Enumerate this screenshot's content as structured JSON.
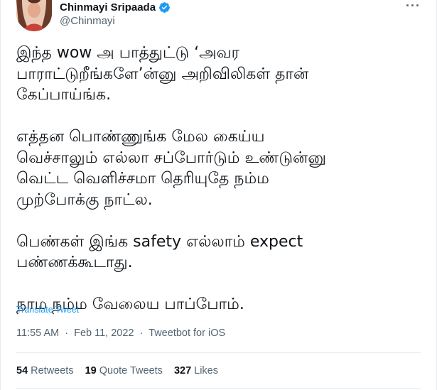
{
  "user": {
    "name": "Chinmayi Sripaada",
    "handle": "@Chinmayi",
    "verified_icon": "verified-badge-icon",
    "verified_color": "#1d9bf0"
  },
  "more_icon": "···",
  "tweet": {
    "paragraphs": [
      "இந்த wow அ பாத்துட்டு ‘அவர\nபாராட்டுறீங்களே’ன்னு அறிவிலிகள் தான்\nகேப்பாய்ங்க.",
      "எத்தன பொண்ணுங்க மேல கைய்ய\nவெச்சாலும் எல்லா சப்போர்டும் உண்டுன்னு\nவெட்ட வெளிச்சமா தெரியுதே நம்ம\nமுற்போக்கு நாட்ல.",
      "பெண்கள் இங்க safety எல்லாம் expect\nபண்ணக்கூடாது.",
      "நாம நம்ம வேலைய பாப்போம்."
    ],
    "translate_label": "Translate Tweet",
    "time": "11:55 AM",
    "date": "Feb 11, 2022",
    "client": "Tweetbot for iOS",
    "separator": "·"
  },
  "stats": {
    "retweets_count": "54",
    "retweets_label": "Retweets",
    "quotes_count": "19",
    "quotes_label": "Quote Tweets",
    "likes_count": "327",
    "likes_label": "Likes"
  },
  "colors": {
    "text": "#0f1419",
    "secondary": "#536471",
    "link": "#1d9bf0"
  }
}
